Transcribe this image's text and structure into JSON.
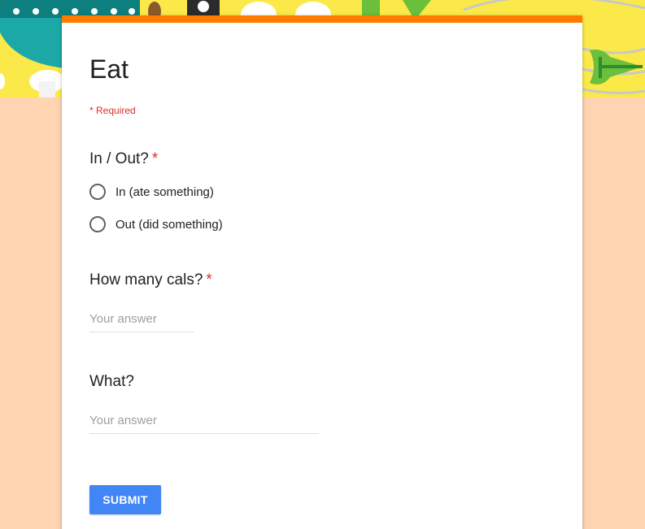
{
  "form": {
    "title": "Eat",
    "required_note": "* Required",
    "accent_color": "#ff7a00",
    "background_color": "#ffd4b0",
    "banner_color": "#fbe94a"
  },
  "questions": [
    {
      "title": "In / Out?",
      "required_mark": "*",
      "type": "radio",
      "options": [
        "In (ate something)",
        "Out (did something)"
      ]
    },
    {
      "title": "How many cals?",
      "required_mark": "*",
      "type": "text",
      "placeholder": "Your answer"
    },
    {
      "title": "What?",
      "type": "text",
      "placeholder": "Your answer"
    }
  ],
  "submit": {
    "label": "SUBMIT",
    "color": "#4285f4"
  },
  "banner_icons": [
    "bowl-icon",
    "almond-icon",
    "pepper-grinder-icon",
    "egg-icon",
    "mushroom-icon",
    "celery-icon",
    "whisk-icon",
    "broccoli-icon"
  ]
}
